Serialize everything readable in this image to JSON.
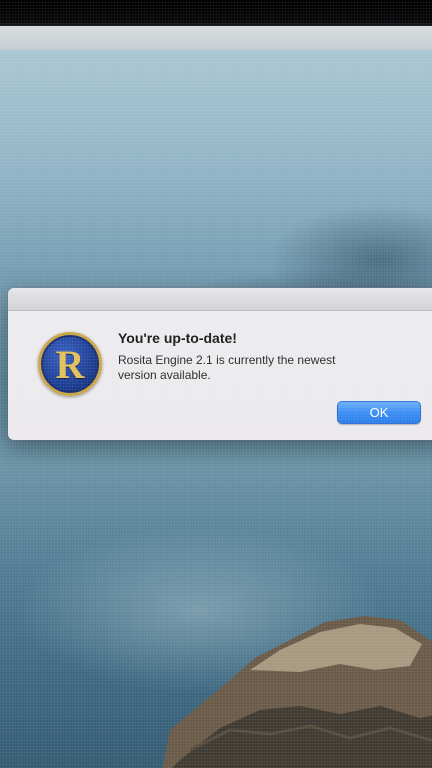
{
  "alert": {
    "title": "You're up-to-date!",
    "message": "Rosita Engine 2.1 is currently the newest version available.",
    "ok_label": "OK",
    "icon_letter": "R",
    "icon": "rosita-engine-app-icon"
  },
  "colors": {
    "accent_button": "#3a8ef3",
    "icon_blue": "#1e3f95",
    "icon_gold": "#c9a646"
  }
}
